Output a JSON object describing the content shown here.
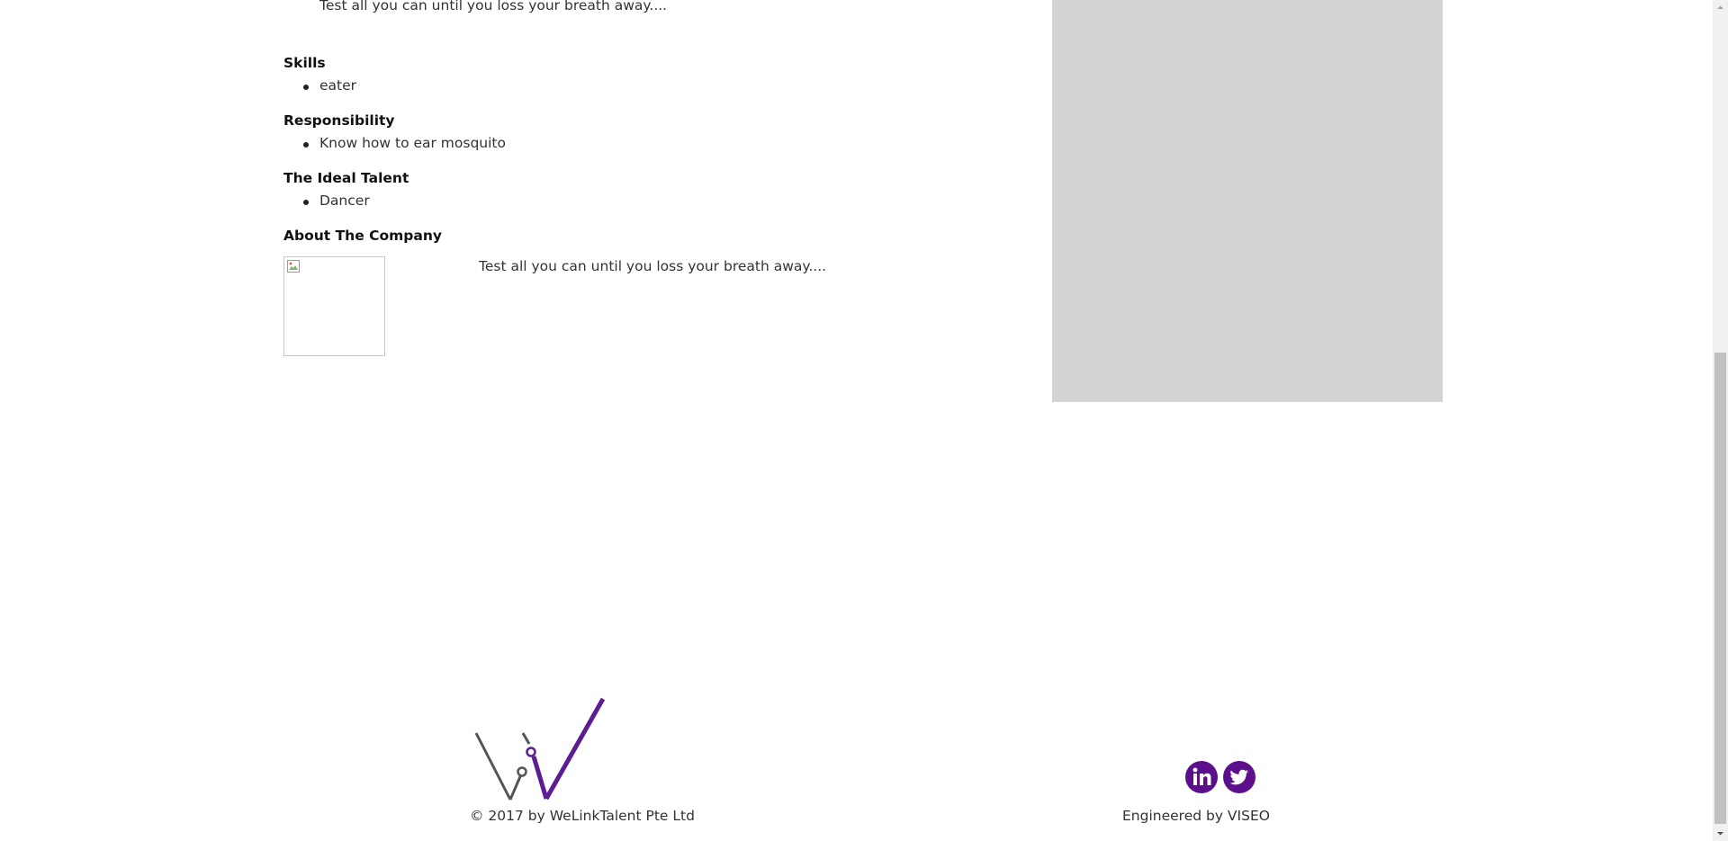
{
  "job": {
    "description_text": "Test all you can until you loss your breath away....",
    "skills_title": "Skills",
    "skills": [
      "eater"
    ],
    "responsibility_title": "Responsibility",
    "responsibilities": [
      "Know how to ear mosquito"
    ],
    "ideal_talent_title": "The Ideal Talent",
    "ideal_talents": [
      "Dancer"
    ],
    "about_company_title": "About The Company",
    "about_company_text": "Test all you can until you loss your breath away...."
  },
  "footer": {
    "copyright": "© 2017 by WeLinkTalent Pte Ltd",
    "engineered_by": "Engineered by VISEO",
    "social_icons": [
      "linkedin-icon",
      "twitter-icon"
    ],
    "brand_color": "#5b0f8a"
  },
  "colors": {
    "side_panel": "#d3d3d3",
    "text": "#333333",
    "logo_gray": "#555555",
    "logo_purple": "#5b1d91"
  }
}
